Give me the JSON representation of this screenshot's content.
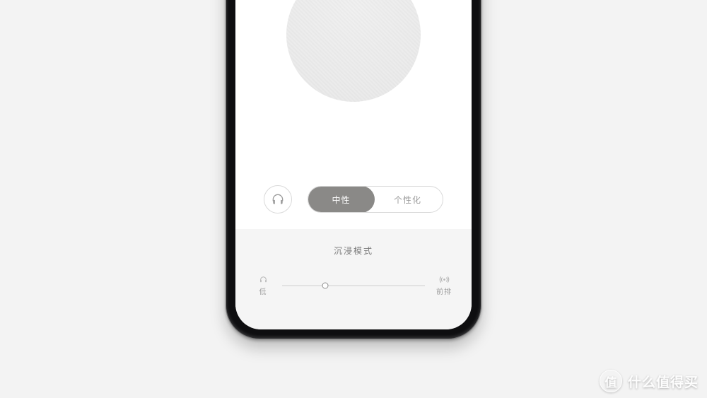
{
  "segmented": {
    "neutral": "中性",
    "personalized": "个性化",
    "selected": "neutral"
  },
  "mode": {
    "title": "沉浸模式",
    "low_icon": "headphones-small-icon",
    "high_icon": "sound-waves-icon",
    "low_label": "低",
    "high_label": "前排",
    "slider_value": 0.3
  },
  "icons": {
    "headphones": "headphones-icon"
  },
  "watermark": {
    "logo_char": "值",
    "text": "什么值得买"
  },
  "colors": {
    "segment_selected_bg": "#8a8987",
    "segment_border": "#d9d9d9",
    "text_muted": "#9a9a9a",
    "panel_bg": "#f5f5f5"
  }
}
